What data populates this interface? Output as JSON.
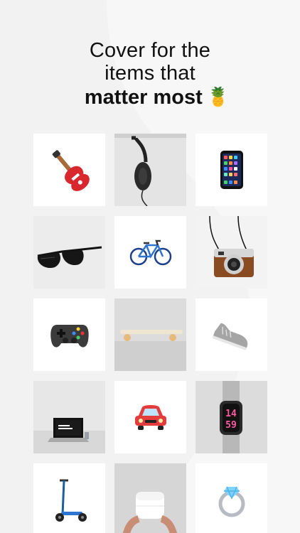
{
  "headline": {
    "line1": "Cover for the",
    "line2": "items that",
    "line3_bold": "matter most",
    "emoji": "🍍"
  },
  "items": [
    {
      "name": "guitar-icon"
    },
    {
      "name": "headphones-photo"
    },
    {
      "name": "smartphone-icon"
    },
    {
      "name": "sunglasses-photo"
    },
    {
      "name": "bicycle-icon"
    },
    {
      "name": "camera-photo"
    },
    {
      "name": "game-controller-icon"
    },
    {
      "name": "skateboard-photo"
    },
    {
      "name": "sneaker-icon"
    },
    {
      "name": "laptop-photo"
    },
    {
      "name": "car-icon"
    },
    {
      "name": "smartwatch-photo"
    },
    {
      "name": "scooter-icon"
    },
    {
      "name": "earbuds-photo"
    },
    {
      "name": "ring-icon"
    }
  ],
  "watch_time": {
    "hour": "14",
    "minute": "59"
  }
}
